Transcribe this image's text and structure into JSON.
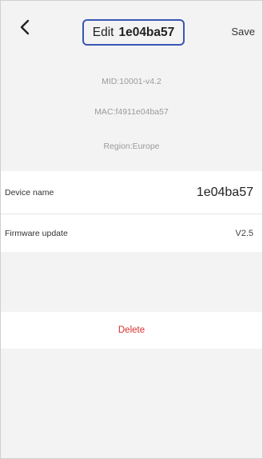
{
  "header": {
    "title_prefix": "Edit",
    "title_device": "1e04ba57",
    "save_label": "Save",
    "back_icon": "chevron-left-icon",
    "highlight_color": "#3a56b5"
  },
  "info": {
    "mid": "MID:10001-v4.2",
    "mac": "MAC:f4911e04ba57",
    "region": "Region:Europe"
  },
  "settings": {
    "device_name_label": "Device name",
    "device_name_value": "1e04ba57",
    "firmware_label": "Firmware update",
    "firmware_value": "V2.5"
  },
  "actions": {
    "delete_label": "Delete",
    "delete_color": "#d9302c"
  }
}
